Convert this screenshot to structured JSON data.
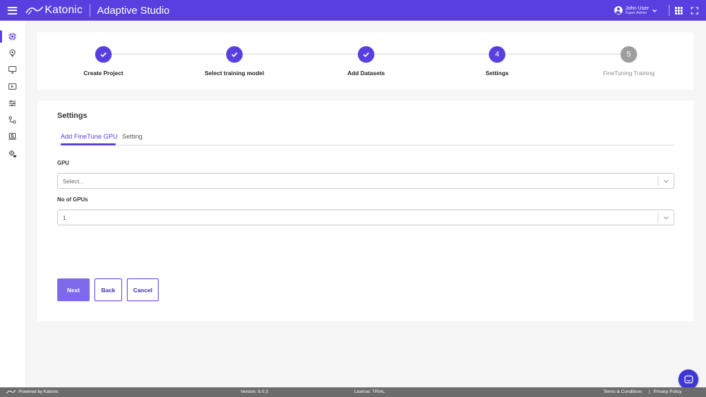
{
  "header": {
    "brand": "Katonic",
    "app_title": "Adaptive Studio",
    "user_name": "John User",
    "user_role": "Super Admin"
  },
  "sidebar": {
    "items": [
      {
        "icon": "chip-icon",
        "active": true
      },
      {
        "icon": "lightbulb-icon",
        "active": false
      },
      {
        "icon": "monitor-icon",
        "active": false
      },
      {
        "icon": "video-settings-icon",
        "active": false
      },
      {
        "icon": "sliders-icon",
        "active": false
      },
      {
        "icon": "workflow-icon",
        "active": false
      },
      {
        "icon": "laptop-search-icon",
        "active": false
      },
      {
        "icon": "gear-lock-icon",
        "active": false
      }
    ]
  },
  "stepper": {
    "steps": [
      {
        "number": "1",
        "label": "Create Project",
        "status": "done"
      },
      {
        "number": "2",
        "label": "Select training model",
        "status": "done"
      },
      {
        "number": "3",
        "label": "Add Datasets",
        "status": "done"
      },
      {
        "number": "4",
        "label": "Settings",
        "status": "current"
      },
      {
        "number": "5",
        "label": "FineTuning Training",
        "status": "pending"
      }
    ]
  },
  "settings": {
    "title": "Settings",
    "tabs": [
      {
        "label": "Add FineTune GPU",
        "active": true
      },
      {
        "label": "Setting",
        "active": false
      }
    ],
    "gpu_label": "GPU",
    "gpu_placeholder": "Select...",
    "num_gpus_label": "No of GPUs",
    "num_gpus_value": "1",
    "buttons": {
      "next": "Next",
      "back": "Back",
      "cancel": "Cancel"
    }
  },
  "footer": {
    "powered_by": "Powered by Katonic",
    "version": "Version: 6.0.3",
    "license": "License: TRIAL",
    "terms": "Terms & Conditions",
    "separator": "|",
    "privacy": "Privacy Policy"
  },
  "colors": {
    "primary": "#5a3fe0",
    "primary_light": "#7e69ea",
    "pending": "#9e9e9e",
    "footer": "#6c6c6c"
  }
}
